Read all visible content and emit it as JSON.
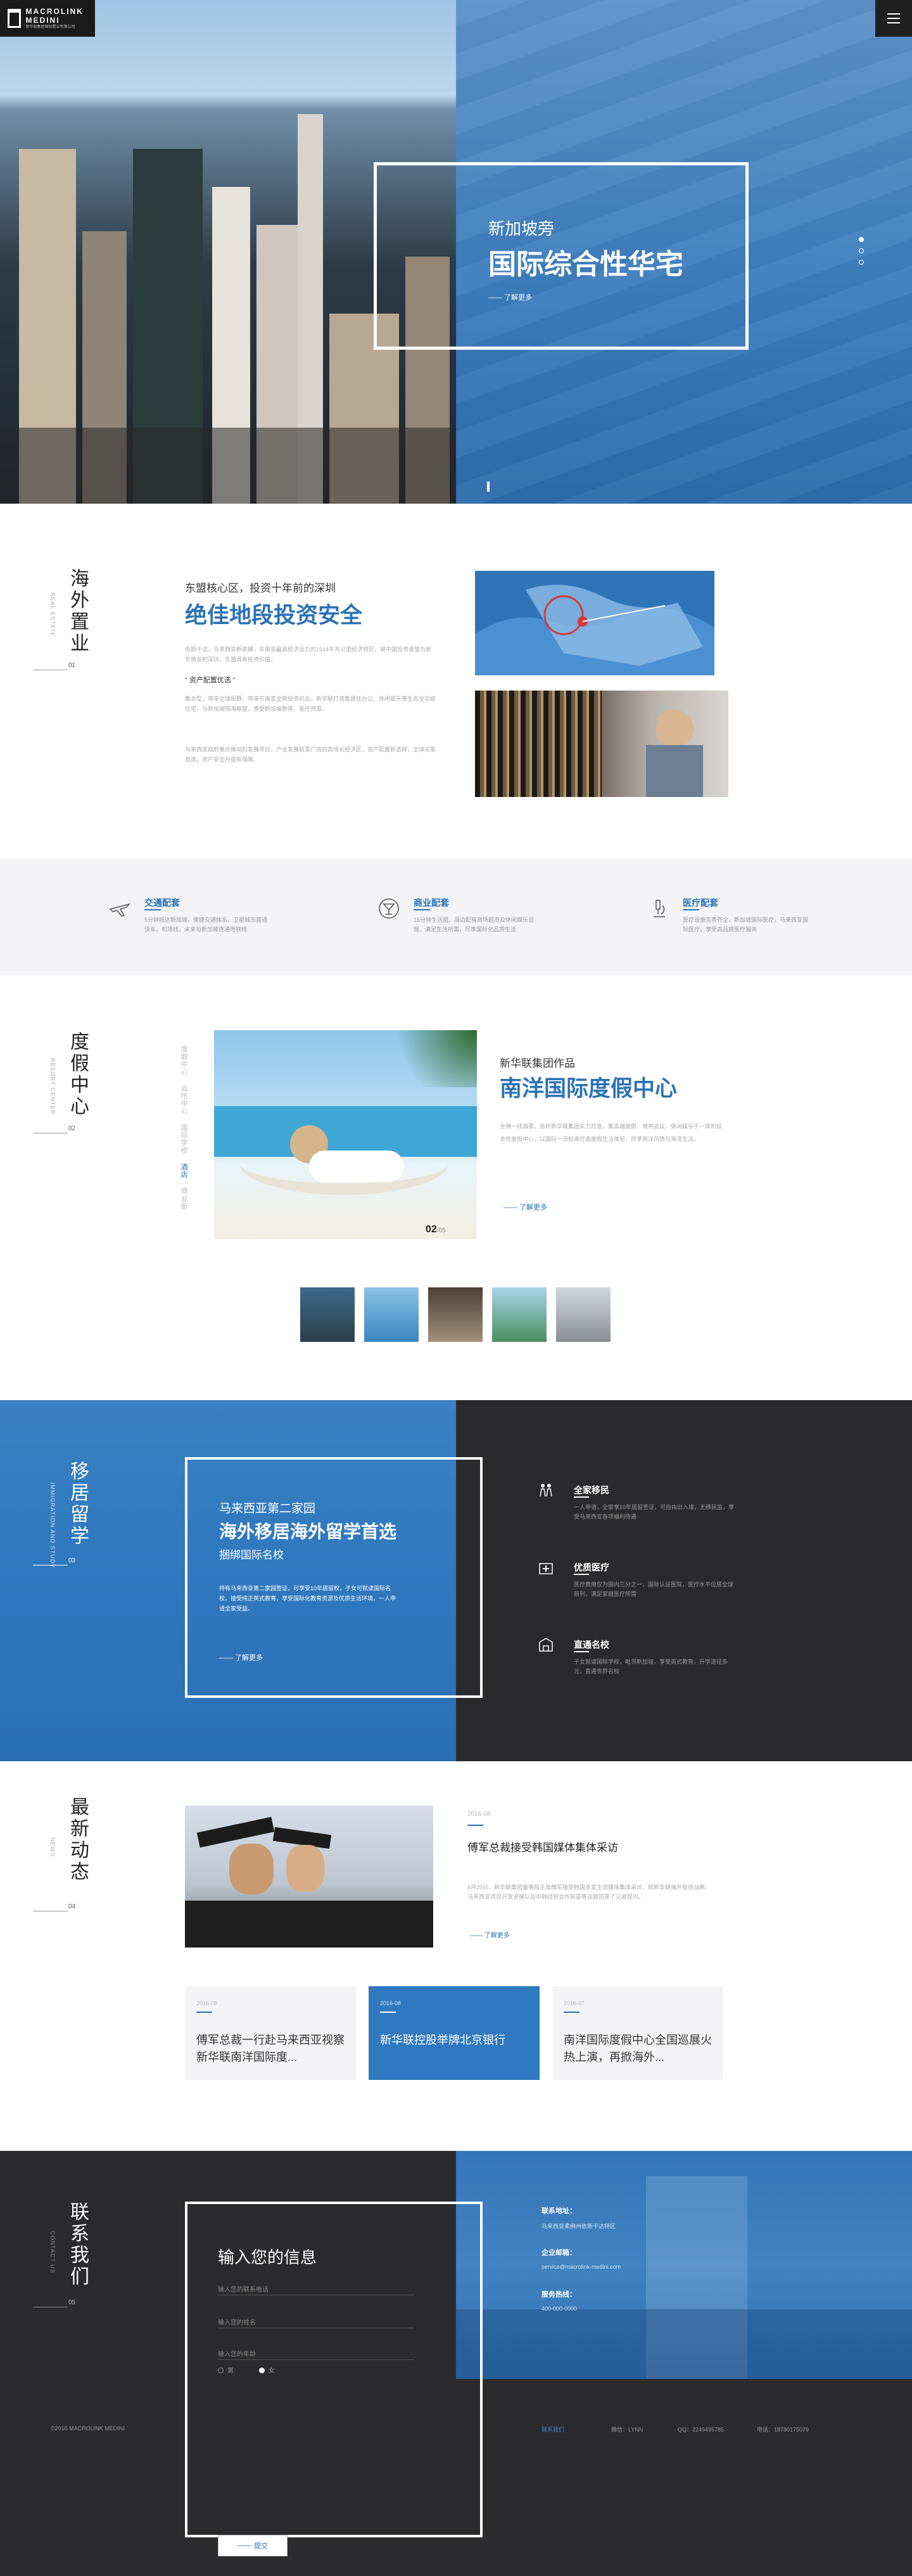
{
  "brand": {
    "name": "MACROLINK MEDINI",
    "sub": "新华联集团国际置业有限公司"
  },
  "hero": {
    "subtitle": "新加坡旁",
    "title": "国际综合性华宅",
    "more": "了解更多"
  },
  "invest": {
    "vtitle": "海外置业",
    "vsub": "REAL ESTATE",
    "num": "01",
    "small": "东盟核心区，投资十年前的深圳",
    "big": "绝佳地段投资安全",
    "p1": "依斯干达，马来西亚新发展，东南亚最具经济活力的1944平方公里经济特区，被中国投资者誉为是东南亚的深圳，东盟具有投资价值。",
    "tag": "资产配置优选",
    "p2": "集合型，带来全球视野，带来东南亚全新投资机会，新华联打造集居住办公、休闲娱乐等生态全功能住宅，与新加坡隔海相望，享受新加坡教育、医疗资源。",
    "p3": "马来西亚政府重点推动的发展项目，产业发展前景广阔的高增长经济区，资产配置新选择，全球买家首选，资产安全升值有保障。"
  },
  "features": [
    {
      "title": "交通配套",
      "desc": "5分钟抵达新加坡，便捷交通体系，卫星城市直通快车，机场线，未来与新加坡连通地铁线"
    },
    {
      "title": "商业配套",
      "desc": "15分钟生活圈，周边配有商场超市及休闲娱乐设施，满足生活所需，尽享国际化品质生活"
    },
    {
      "title": "医疗配套",
      "desc": "医疗设施完善齐全，新加坡国际医疗，马来西亚国际医疗，享受高品质医疗服务"
    }
  ],
  "resort": {
    "vtitle": "度假中心",
    "vsub": "RESORT CENTER",
    "num": "02",
    "tabs": [
      "度假中心",
      "会所中心",
      "国际学校",
      "酒店",
      "商业街"
    ],
    "small": "新华联集团作品",
    "big": "南洋国际度假中心",
    "p": "坐拥一线海景，依托新华联集团实力打造，集高端度假、商务会议、休闲娱乐于一体的综合性度假中心，以国际一流标准打造度假生活体验，尽享南洋风情与海滨生活。",
    "more": "了解更多",
    "page": "02",
    "total": "/05"
  },
  "migr": {
    "vtitle": "移居留学",
    "vsub": "IMMIGRATION AND STUDY",
    "num": "03",
    "a": "马来西亚第二家园",
    "b": "海外移居海外留学首选",
    "c": "捆绑国际名校",
    "d": "持有马来西亚第二家园签证，可享受10年居留权，子女可就读国际名校，接受纯正英式教育，享受国际化教育资源及优质生活环境，一人申请全家受益。",
    "more": "了解更多",
    "items": [
      {
        "title": "全家移民",
        "desc": "一人申请，全家享10年居留签证，可自由出入境，无移民监，享受马来西亚各项福利待遇"
      },
      {
        "title": "优质医疗",
        "desc": "医疗费用仅为国内三分之一，国际认证医院，医疗水平位居全球前列，满足家庭医疗所需"
      },
      {
        "title": "直通名校",
        "desc": "子女就读国际学校，毗邻新加坡，享受英式教育，升学途径多元，直通世界名校"
      }
    ]
  },
  "news": {
    "vtitle": "最新动态",
    "vsub": "NEWS",
    "num": "04",
    "date": "2016-08",
    "title": "傅军总裁接受韩国媒体集体采访",
    "p": "8月25日，新华联集团董事局主席傅军接受韩国多家主流媒体集体采访，就新华联海外投资战略、马来西亚项目开发进展以及中韩经贸合作前景等话题回答了记者提问。",
    "more": "了解更多",
    "cards": [
      {
        "date": "2016-08",
        "title": "傅军总裁一行赴马来西亚视察新华联南洋国际度..."
      },
      {
        "date": "2016-08",
        "title": "新华联控股举牌北京银行"
      },
      {
        "date": "2016-07",
        "title": "南洋国际度假中心全国巡展火热上演，再掀海外..."
      }
    ]
  },
  "contact": {
    "vtitle": "联系我们",
    "vsub": "CONTACT US",
    "num": "05",
    "form_title": "输入您的信息",
    "fields": [
      "输入您的联系电话",
      "输入您的姓名",
      "输入您的年龄"
    ],
    "male": "男",
    "female": "女",
    "submit": "提交",
    "info": [
      {
        "h": "联系地址：",
        "v": "马来西亚柔佛州依斯干达特区"
      },
      {
        "h": "企业邮箱：",
        "v": "service@macrolink-medini.com"
      },
      {
        "h": "服务热线：",
        "v": "400-000-0000"
      }
    ],
    "copyright": "©2016 MACROLINK MEDINI",
    "footer_link": "联系我们",
    "wechat": "微信：LYNN",
    "qq": "QQ：2249495785",
    "phone": "电话：18780175079"
  }
}
